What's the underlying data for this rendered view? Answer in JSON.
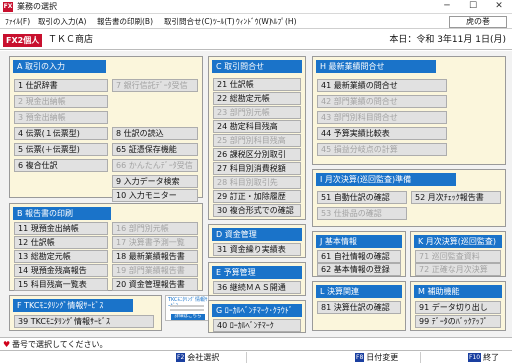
{
  "window": {
    "title": "業務の選択",
    "icon_text": "FX",
    "minimize": "─",
    "maximize": "☐",
    "close": "✕"
  },
  "menu": [
    "ﾌｧｲﾙ(F)",
    "取引の入力(A)",
    "報告書の印刷(B)",
    "取引問合せ(C)",
    "ﾂｰﾙ(T)",
    "ｳｨﾝﾄﾞｳ(W)",
    "ﾍﾙﾌﾟ(H)"
  ],
  "help_box": "虎の巻",
  "info": {
    "badge": "FX2個人",
    "company": "ＴＫＣ商店",
    "today": "本日：令和 3年11月 1日(月)"
  },
  "panels": {
    "A": {
      "title": "A 取引の入力",
      "items": [
        "1 仕訳辞書",
        "2 現金出納帳",
        "3 預金出納帳",
        "4 伝票(１伝票型)",
        "5 伝票(＋伝票型)",
        "6 複合仕訳",
        "7 銀行信託ﾃﾞｰﾀ受信",
        "8 仕訳の読込",
        "65 証憑保存機能",
        "66 かんたんﾃﾞｰﾀ受信",
        "9 入力データ検索",
        "10 入力モニター"
      ]
    },
    "B": {
      "title": "B 報告書の印刷",
      "items": [
        "11 現預金出納帳",
        "12 仕訳帳",
        "13 総勘定元帳",
        "14 現預金残高報告",
        "15 科目残高一覧表",
        "16 部門別元帳",
        "17 決算書予測一覧",
        "18 最新業績報告書",
        "19 部門業績報告書",
        "20 資金管理報告書"
      ]
    },
    "C": {
      "title": "C 取引問合せ",
      "items": [
        "21 仕訳帳",
        "22 総勘定元帳",
        "23 部門別元帳",
        "24 勘定科目残高",
        "25 部門別科目残高",
        "26 課税区分別取引",
        "27 科目別消費税額",
        "28 科目別取引先",
        "29 訂正・加除履歴",
        "30 複合形式での確認"
      ]
    },
    "D": {
      "title": "D 資金管理",
      "items": [
        "31 資金繰り実績表"
      ]
    },
    "E": {
      "title": "E 予算管理",
      "items": [
        "36 継続ＭＡＳ開通"
      ]
    },
    "G": {
      "title": "G ﾛｰｶﾙﾍﾞﾝﾁﾏｰｸ･ｸﾗｳﾄﾞ",
      "items": [
        "40 ﾛｰｶﾙﾍﾞﾝﾁﾏｰｸ"
      ]
    },
    "H": {
      "title": "H 最新業績問合せ",
      "items": [
        "41 最新業績の問合せ",
        "42 部門業績の問合せ",
        "43 部門別科目問合せ",
        "44 予算実績比較表",
        "45 損益分岐点の計算"
      ]
    },
    "I": {
      "title": "I 月次決算(巡回監査)準備",
      "items": [
        "51 自動仕訳の確認",
        "52 月次ﾁｪｯｸ報告書",
        "53 仕掛品の確認"
      ]
    },
    "J": {
      "title": "J 基本情報",
      "items": [
        "61 自社情報の確認",
        "62 基本情報の登録"
      ]
    },
    "K": {
      "title": "K 月次決算(巡回監査)",
      "items": [
        "71 巡回監査資料",
        "72 正確な月次決算"
      ]
    },
    "L": {
      "title": "L 決算関連",
      "items": [
        "81 決算仕訳の確認"
      ]
    },
    "M": {
      "title": "M 補助機能",
      "items": [
        "91 データ切り出し",
        "99 ﾃﾞｰﾀのﾊﾞｯｸｱｯﾌﾟ"
      ]
    },
    "F": {
      "title": "F TKCﾓﾆﾀﾘﾝｸﾞ情報ｻｰﾋﾞｽ",
      "items": [
        "39 TKCﾓﾆﾀﾘﾝｸﾞ情報ｻｰﾋﾞｽ"
      ]
    }
  },
  "ad": {
    "title": "TKCﾓﾆﾀﾘﾝｸﾞ情報ｻｰﾋﾞｽ",
    "button": "詳細はこちら"
  },
  "status": {
    "text": "番号で選択してください。"
  },
  "fkeys": [
    {
      "key": "F2",
      "label": "会社選択"
    },
    {
      "key": "F8",
      "label": "日付変更"
    },
    {
      "key": "F10",
      "label": "終了"
    }
  ],
  "colors": {
    "accent": "#1a73c9",
    "panel_bg": "#fbf6dc",
    "brand_red": "#c8102e"
  }
}
